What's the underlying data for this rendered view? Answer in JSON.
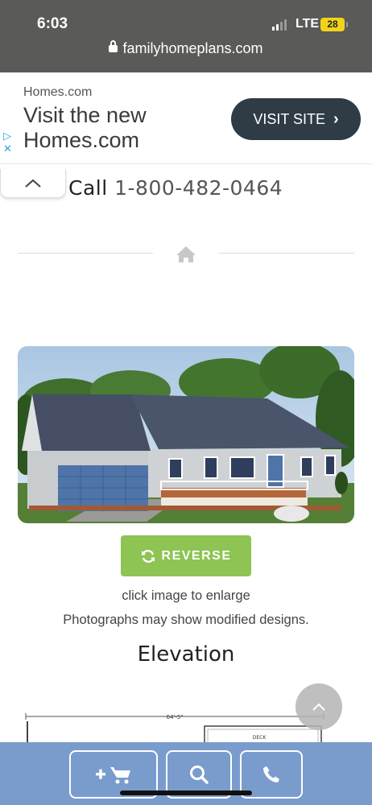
{
  "status_bar": {
    "time": "6:03",
    "network": "LTE",
    "battery": "28"
  },
  "browser": {
    "url": "familyhomeplans.com"
  },
  "ad": {
    "brand": "Homes.com",
    "headline": "Visit the new Homes.com",
    "cta": "VISIT SITE"
  },
  "header": {
    "call_label": "Call",
    "phone": "1-800-482-0464"
  },
  "image": {
    "reverse_label": "REVERSE",
    "hint": "click image to enlarge",
    "disclaimer": "Photographs may show modified designs."
  },
  "section": {
    "title": "Elevation"
  },
  "floorplan": {
    "dimension": "64'-5\"",
    "room_label": "DECK"
  },
  "colors": {
    "accent_green": "#8dc453",
    "bottom_bar": "#7a9ccd",
    "ad_button": "#2f3b45"
  }
}
